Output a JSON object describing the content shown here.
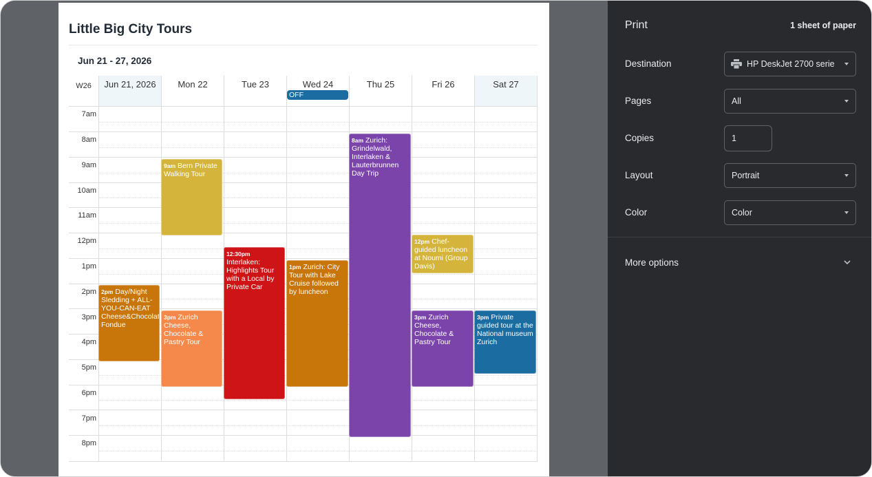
{
  "calendar": {
    "title": "Little Big City Tours",
    "date_range": "Jun 21 - 27, 2026",
    "week_label": "W26",
    "days": [
      "Jun 21, 2026",
      "Mon 22",
      "Tue 23",
      "Wed 24",
      "Thu 25",
      "Fri 26",
      "Sat 27"
    ],
    "hours": [
      "7am",
      "8am",
      "9am",
      "10am",
      "11am",
      "12pm",
      "1pm",
      "2pm",
      "3pm",
      "4pm",
      "5pm",
      "6pm",
      "7pm",
      "8pm"
    ],
    "all_day_event": "OFF",
    "events": [
      {
        "time": "2pm",
        "title": "Day/Night Sledding + ALL-YOU-CAN-EAT Cheese&Chocolate Fondue",
        "color": "#c8760a"
      },
      {
        "time": "9am",
        "title": "Bern Private Walking Tour",
        "color": "#d4b43a"
      },
      {
        "time": "3pm",
        "title": "Zurich Cheese, Chocolate & Pastry Tour",
        "color": "#f4894b"
      },
      {
        "time": "12:30pm",
        "title": "Interlaken: Highlights Tour with a Local by Private Car",
        "color": "#cf1417"
      },
      {
        "time": "1pm",
        "title": "Zurich: City Tour with Lake Cruise followed by luncheon",
        "color": "#c8760a"
      },
      {
        "time": "8am",
        "title": "Zurich: Grindelwald, Interlaken & Lauterbrunnen Day Trip",
        "color": "#7b44ab"
      },
      {
        "time": "12pm",
        "title": "Chef-guided luncheon at Noumi (Group Davis)",
        "color": "#d4b43a"
      },
      {
        "time": "3pm",
        "title": "Zurich Cheese, Chocolate & Pastry Tour",
        "color": "#7b44ab"
      },
      {
        "time": "3pm",
        "title": "Private guided tour at the National museum Zurich",
        "color": "#1b6ca0"
      }
    ]
  },
  "print": {
    "title": "Print",
    "sheets": "1 sheet of paper",
    "destination_label": "Destination",
    "destination_value": "HP DeskJet 2700 serie",
    "pages_label": "Pages",
    "pages_value": "All",
    "copies_label": "Copies",
    "copies_value": "1",
    "layout_label": "Layout",
    "layout_value": "Portrait",
    "color_label": "Color",
    "color_value": "Color",
    "more_options": "More options"
  }
}
